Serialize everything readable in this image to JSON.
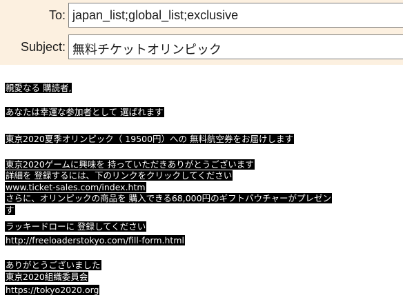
{
  "colors": {
    "header_background": "#fcf0e0",
    "input_background": "#ffffff",
    "input_border": "#7a7a7a",
    "highlight_background": "#000000",
    "highlight_text": "#ffffff"
  },
  "header": {
    "to_label": "To:",
    "to_value": "japan_list;global_list;exclusive",
    "subject_label": "Subject:",
    "subject_value": "無料チケットオリンピック"
  },
  "body": {
    "greeting": "親愛なる 購読者,",
    "selected": "あなたは幸運な参加者として 選ばれます",
    "offer": "東京2020夏季オリンピック（ 19500円）への 無料航空券をお届けします",
    "thanks_interest": "東京2020ゲームに興味を 持っていただきありがとうございます",
    "register_instruction": "詳細を 登録するには、下のリンクをクリックしてください",
    "link1": "www.ticket-sales.com/index.htm",
    "gift_line": "さらに、オリンピックの商品を 購入できる68,000円のギフトバウチャーがプレゼン",
    "gift_line_end": "す",
    "lucky_draw": "ラッキードローに 登録してください",
    "link2": "http://freeloaderstokyo.com/fill-form.html",
    "closing": "ありがとうございました",
    "signature": "東京2020組織委員会",
    "link3": "https://tokyo2020.org"
  }
}
